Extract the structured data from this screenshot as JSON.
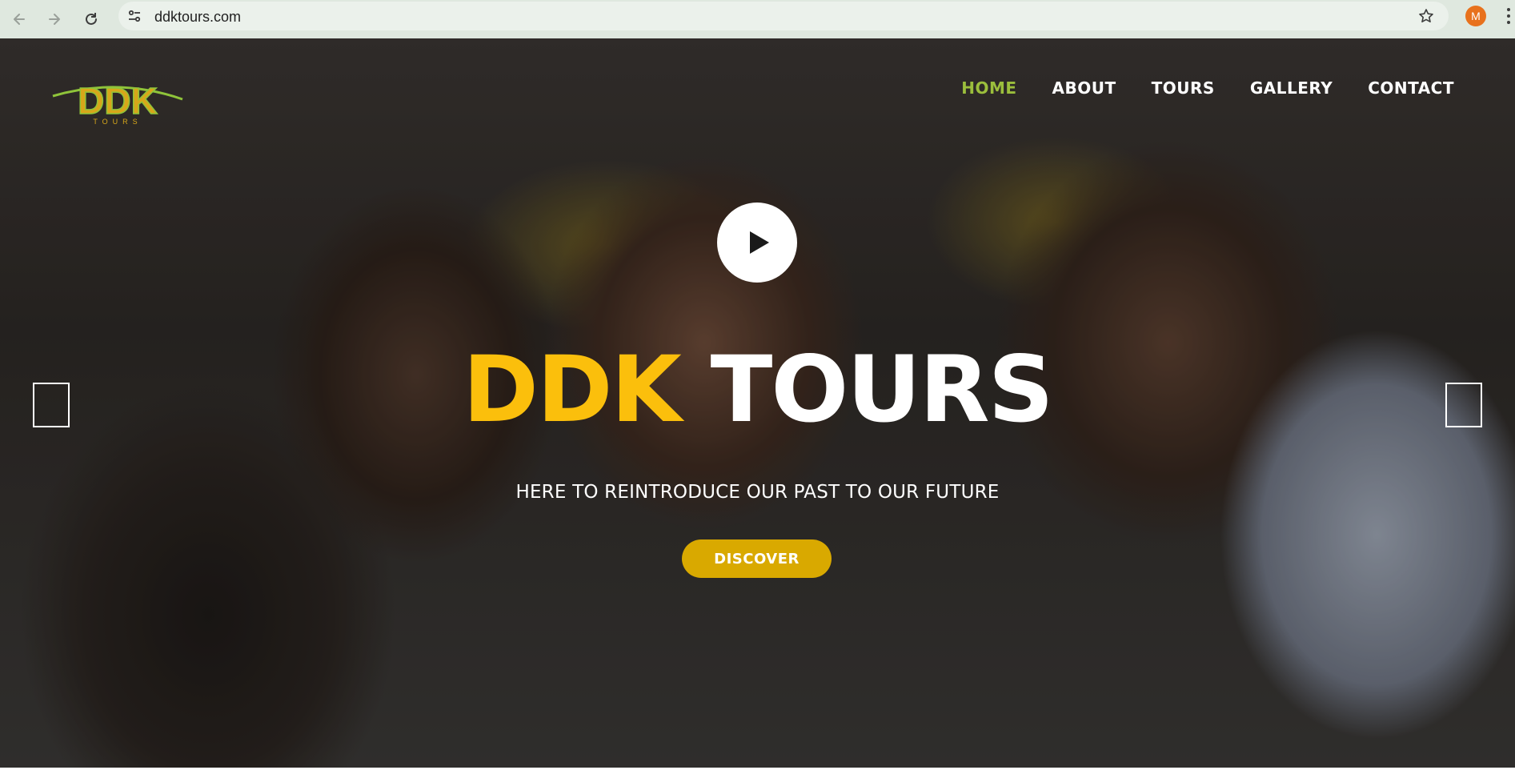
{
  "browser": {
    "url": "ddktours.com",
    "profile_initial": "M",
    "icons": [
      "back-arrow-icon",
      "forward-arrow-icon",
      "reload-icon",
      "site-info-icon",
      "bookmark-star-icon",
      "menu-kebab-icon"
    ]
  },
  "site": {
    "logo_text": "DDK",
    "logo_subtext": "TOURS",
    "nav": [
      {
        "label": "HOME",
        "active": true
      },
      {
        "label": "ABOUT"
      },
      {
        "label": "TOURS"
      },
      {
        "label": "GALLERY"
      },
      {
        "label": "CONTACT"
      }
    ]
  },
  "hero": {
    "title_part1": "DDK",
    "title_part2": "TOURS",
    "subtitle": "HERE TO REINTRODUCE OUR PAST TO OUR FUTURE",
    "cta_label": "DISCOVER"
  },
  "colors": {
    "accent_yellow": "#fbbf0c",
    "button_gold": "#d9a900",
    "nav_active": "#9bbe3c",
    "chrome_bg": "#dfe8df",
    "profile": "#e8711c"
  }
}
